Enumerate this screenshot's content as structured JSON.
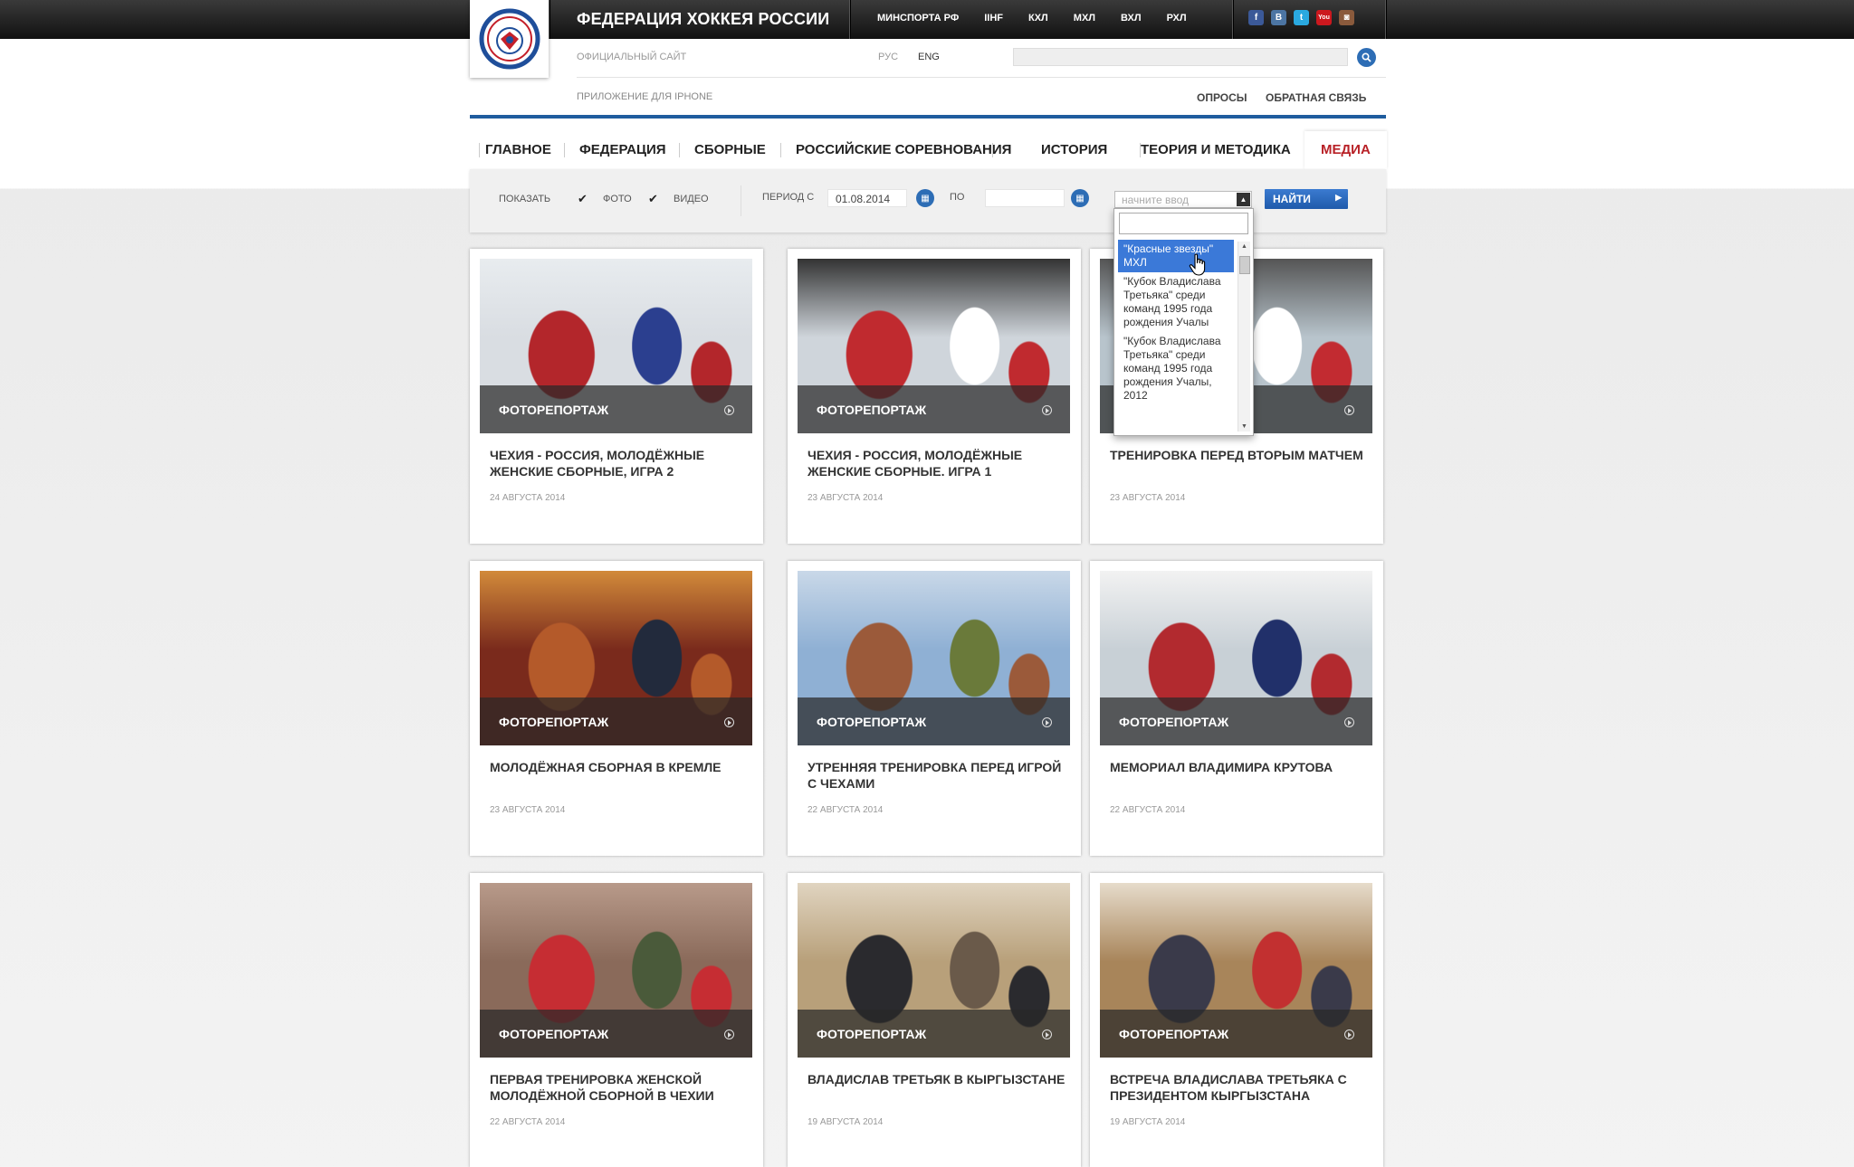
{
  "header": {
    "site_title": "ФЕДЕРАЦИЯ ХОККЕЯ РОССИИ",
    "league_links": [
      "МИНСПОРТА РФ",
      "IIHF",
      "КХЛ",
      "МХЛ",
      "ВХЛ",
      "РХЛ"
    ],
    "social": [
      {
        "icon": "facebook-icon",
        "glyph": "f",
        "color": "#3b5998"
      },
      {
        "icon": "vkontakte-icon",
        "glyph": "B",
        "color": "#4c75a3"
      },
      {
        "icon": "twitter-icon",
        "glyph": "t",
        "color": "#2aa9e0"
      },
      {
        "icon": "youtube-icon",
        "glyph": "You",
        "color": "#cc181e"
      },
      {
        "icon": "instagram-icon",
        "glyph": "◙",
        "color": "#8a5a3c"
      }
    ],
    "official_site": "ОФИЦИАЛЬНЫЙ САЙТ",
    "lang_ru": "РУС",
    "lang_en": "ENG",
    "iphone_app": "ПРИЛОЖЕНИЕ ДЛЯ IPHONE",
    "polls": "ОПРОСЫ",
    "feedback": "ОБРАТНАЯ СВЯЗЬ"
  },
  "nav": [
    "ГЛАВНОЕ",
    "ФЕДЕРАЦИЯ",
    "СБОРНЫЕ",
    "РОССИЙСКИЕ СОРЕВНОВАНИЯ",
    "ИСТОРИЯ",
    "ТЕОРИЯ И МЕТОДИКА",
    "МЕДИА"
  ],
  "filter": {
    "show_label": "ПОКАЗАТЬ",
    "photo_label": "ФОТО",
    "video_label": "ВИДЕО",
    "period_from_label": "ПЕРИОД С",
    "date_from": "01.08.2014",
    "to_label": "ПО",
    "date_to": "",
    "select_placeholder": "начните ввод",
    "find_button": "НАЙТИ",
    "dropdown_items": [
      "\"Красные звезды\" МХЛ",
      "\"Кубок Владислава Третьяка\" среди команд 1995 года рождения Учалы",
      "\"Кубок Владислава Третьяка\" среди команд 1995 года рождения Учалы, 2012"
    ]
  },
  "cards": [
    {
      "label": "ФОТОРЕПОРТАЖ",
      "title": "ЧЕХИЯ - РОССИЯ, МОЛОДЁЖНЫЕ ЖЕНСКИЕ СБОРНЫЕ, ИГРА 2",
      "date": "24 АВГУСТА 2014"
    },
    {
      "label": "ФОТОРЕПОРТАЖ",
      "title": "ЧЕХИЯ - РОССИЯ, МОЛОДЁЖНЫЕ ЖЕНСКИЕ СБОРНЫЕ. ИГРА 1",
      "date": "23 АВГУСТА 2014"
    },
    {
      "label": "ФОТОРЕПОРТАЖ",
      "title": "ТРЕНИРОВКА ПЕРЕД ВТОРЫМ МАТЧЕМ",
      "date": "23 АВГУСТА 2014"
    },
    {
      "label": "ФОТОРЕПОРТАЖ",
      "title": "МОЛОДЁЖНАЯ СБОРНАЯ В КРЕМЛЕ",
      "date": "23 АВГУСТА 2014"
    },
    {
      "label": "ФОТОРЕПОРТАЖ",
      "title": "УТРЕННЯЯ ТРЕНИРОВКА ПЕРЕД ИГРОЙ С ЧЕХАМИ",
      "date": "22 АВГУСТА 2014"
    },
    {
      "label": "ФОТОРЕПОРТАЖ",
      "title": "МЕМОРИАЛ ВЛАДИМИРА КРУТОВА",
      "date": "22 АВГУСТА 2014"
    },
    {
      "label": "ФОТОРЕПОРТАЖ",
      "title": "ПЕРВАЯ ТРЕНИРОВКА ЖЕНСКОЙ МОЛОДЁЖНОЙ СБОРНОЙ В ЧЕХИИ",
      "date": "22 АВГУСТА 2014"
    },
    {
      "label": "ФОТОРЕПОРТАЖ",
      "title": "ВЛАДИСЛАВ ТРЕТЬЯК В КЫРГЫЗСТАНЕ",
      "date": "19 АВГУСТА 2014"
    },
    {
      "label": "ФОТОРЕПОРТАЖ",
      "title": "ВСТРЕЧА ВЛАДИСЛАВА ТРЕТЬЯКА С ПРЕЗИДЕНТОМ КЫРГЫЗСТАНА",
      "date": "19 АВГУСТА 2014"
    }
  ],
  "colors": {
    "accent_blue": "#1f5c9e",
    "active_nav": "#b82127"
  }
}
